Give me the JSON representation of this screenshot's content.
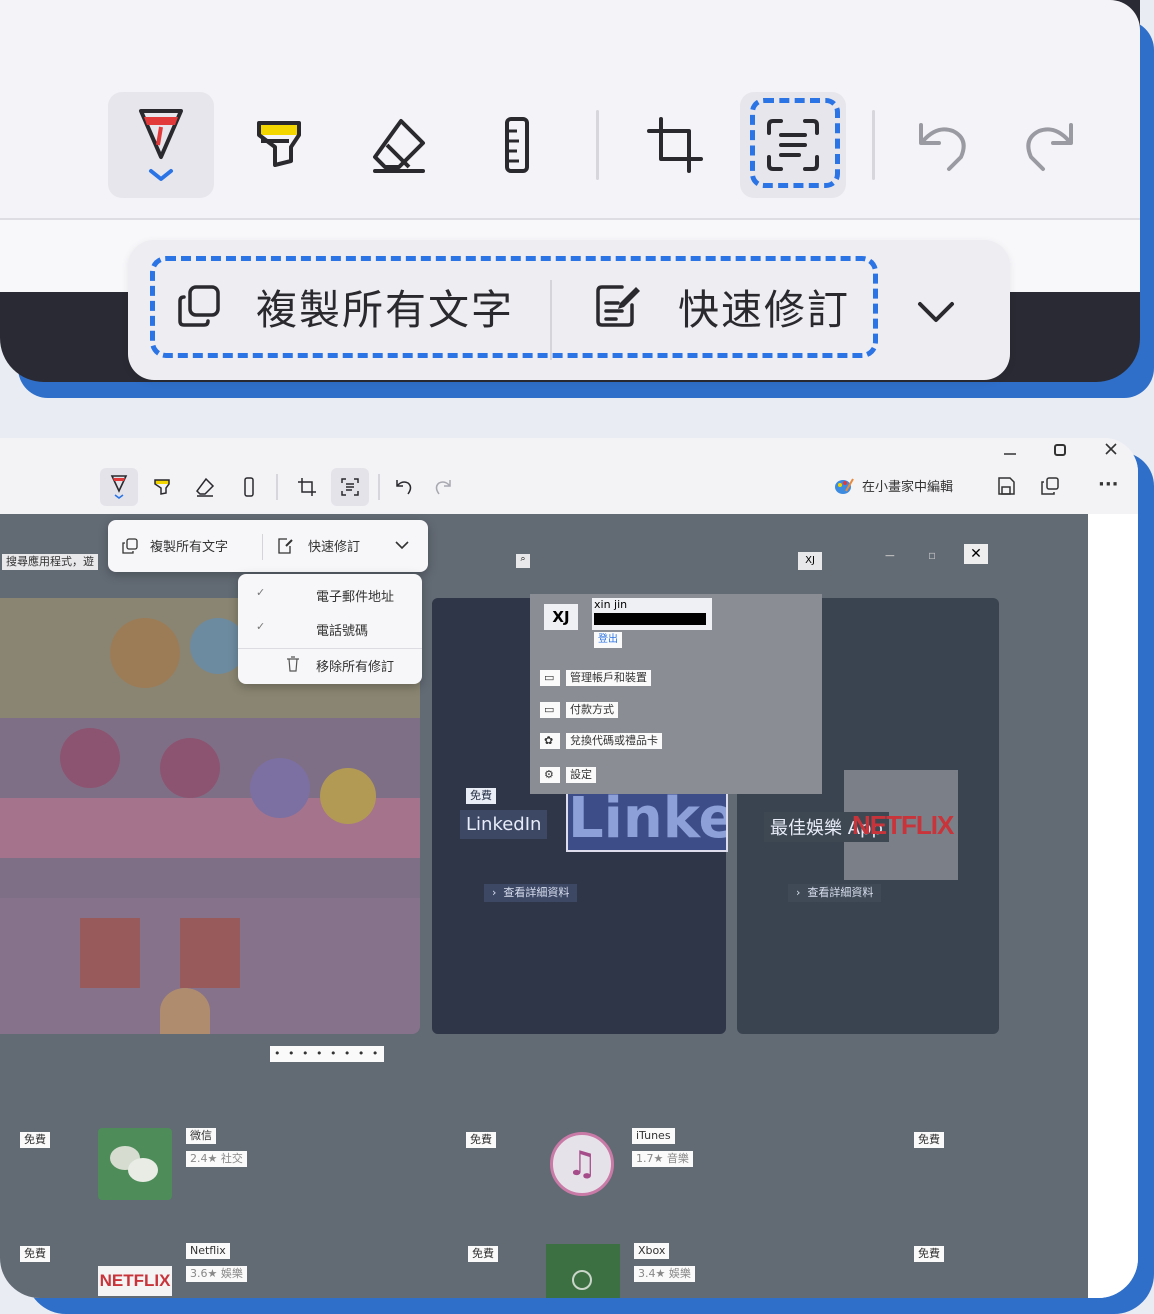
{
  "zoom": {
    "copy_all_text": "複製所有文字",
    "quick_redact": "快速修訂"
  },
  "window": {
    "edit_in_paint": "在小畫家中編輯",
    "more": "···",
    "copy_all_text": "複製所有文字",
    "quick_redact": "快速修訂",
    "redact_menu": {
      "email": "電子郵件地址",
      "phone": "電話號碼",
      "remove_all": "移除所有修訂"
    }
  },
  "screenshot": {
    "search_hint": "搜尋應用程式，遊",
    "account_initials": "XJ",
    "account_badge": "XJ",
    "account_name": "xin jin",
    "sign_out": "登出",
    "menu": {
      "manage": "管理帳戶和裝置",
      "payment": "付款方式",
      "redeem": "兌換代碼或禮品卡",
      "settings": "設定"
    },
    "hero_free": "免費",
    "hero_linkedin": "LinkedIn",
    "hero_linkedin_logo": "Linke",
    "hero_detail_1": "查看詳細資料",
    "hero_entertainment": "最佳娛樂 App",
    "hero_netflix_logo": "NETFLIX",
    "hero_detail_2": "查看詳細資料",
    "free": "免費",
    "apps": [
      {
        "name": "微信",
        "meta": "2.4★  社交"
      },
      {
        "name": "iTunes",
        "meta": "1.7★  音樂"
      },
      {
        "name": "Netflix",
        "meta": "3.6★  娛樂"
      },
      {
        "name": "Xbox",
        "meta": "3.4★  娛樂"
      }
    ],
    "netflix_icon": "NETFLIX",
    "colors": {
      "accent_blue": "#2b74e6",
      "pen_red": "#e23a3a",
      "highlighter_yellow": "#f3d600"
    }
  }
}
